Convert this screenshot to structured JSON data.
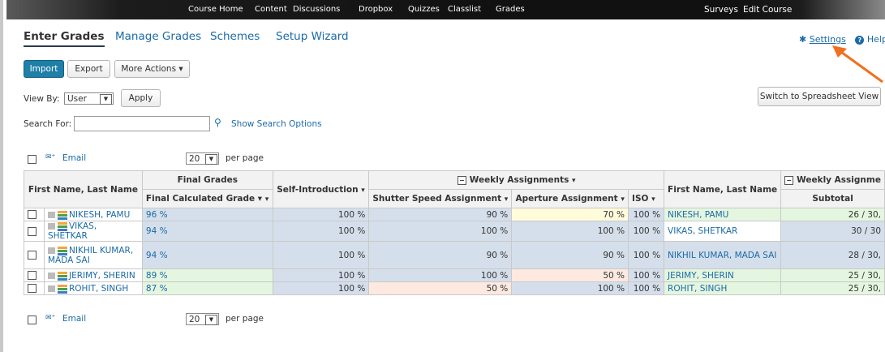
{
  "topnav": {
    "items": [
      "Course Home",
      "Content",
      "Discussions",
      "Dropbox",
      "Quizzes",
      "Classlist",
      "Grades"
    ],
    "right_items": [
      "Surveys",
      "Edit Course"
    ]
  },
  "tabs": [
    "Enter Grades",
    "Manage Grades",
    "Schemes",
    "Setup Wizard"
  ],
  "settings_label": "Settings",
  "help_label": "Help",
  "toolbar": {
    "import": "Import",
    "export": "Export",
    "more_actions": "More Actions ▾"
  },
  "view_by": {
    "label": "View By:",
    "value": "User",
    "apply": "Apply"
  },
  "switch_view": "Switch to Spreadsheet View",
  "search": {
    "label": "Search For:",
    "value": "",
    "options_link": "Show Search Options"
  },
  "email_label": "Email",
  "per_page": {
    "value": "20",
    "label": "per page"
  },
  "headers": {
    "first_last": "First Name, Last Name",
    "final_grades": "Final Grades",
    "final_calc": "Final Calculated Grade ▾",
    "self_intro": "Self-Introduction",
    "weekly": "Weekly Assignments",
    "shutter": "Shutter Speed Assignment",
    "aperture": "Aperture Assignment",
    "iso": "ISO",
    "first_last_2": "First Name, Last Name",
    "weekly_2": "Weekly Assignme",
    "subtotal": "Subtotal"
  },
  "rows": [
    {
      "name": "NIKESH, PAMU",
      "final": "96 %",
      "self": "100 %",
      "shutter": "90 %",
      "aperture": "70 %",
      "iso": "100 %",
      "name2": "NIKESH, PAMU",
      "subtotal": "26 / 30,"
    },
    {
      "name": "VIKAS, SHETKAR",
      "final": "94 %",
      "self": "100 %",
      "shutter": "100 %",
      "aperture": "100 %",
      "iso": "100 %",
      "name2": "VIKAS, SHETKAR",
      "subtotal": "30 / 30"
    },
    {
      "name": "NIKHIL KUMAR, MADA SAI",
      "final": "94 %",
      "self": "100 %",
      "shutter": "90 %",
      "aperture": "90 %",
      "iso": "100 %",
      "name2": "NIKHIL KUMAR, MADA SAI",
      "subtotal": "28 / 30,"
    },
    {
      "name": "JERIMY, SHERIN",
      "final": "89 %",
      "self": "100 %",
      "shutter": "100 %",
      "aperture": "50 %",
      "iso": "100 %",
      "name2": "JERIMY, SHERIN",
      "subtotal": "25 / 30,"
    },
    {
      "name": "ROHIT, SINGH",
      "final": "87 %",
      "self": "100 %",
      "shutter": "50 %",
      "aperture": "100 %",
      "iso": "100 %",
      "name2": "ROHIT, SINGH",
      "subtotal": "25 / 30,"
    }
  ],
  "colors": {
    "accent": "#1e7fa8",
    "link": "#1a6aa8",
    "arrow": "#f07020"
  }
}
